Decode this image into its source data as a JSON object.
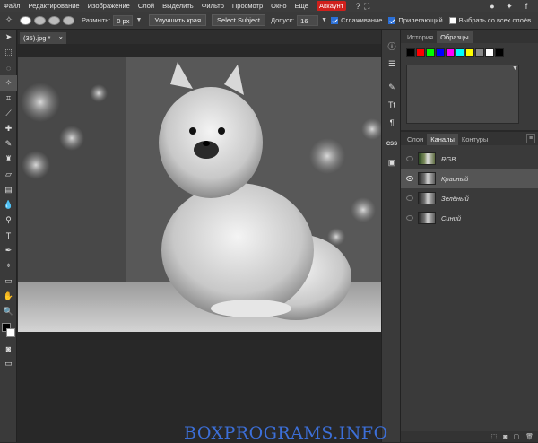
{
  "menubar": {
    "items": [
      "Файл",
      "Редактирование",
      "Изображение",
      "Слой",
      "Выделить",
      "Фильтр",
      "Просмотр",
      "Окно",
      "Ещё"
    ],
    "account": "Аккаунт"
  },
  "options": {
    "feather_label": "Размыть:",
    "feather_value": "0 px",
    "refine_edge": "Улучшить края",
    "select_subject": "Select Subject",
    "tolerance_label": "Допуск:",
    "tolerance_value": "16",
    "antialias_label": "Сглаживание",
    "contiguous_label": "Прилегающий",
    "sample_all_label": "Выбрать со всех слоёв"
  },
  "document": {
    "tab_name": "(35).jpg *",
    "close": "×"
  },
  "top_panel": {
    "tabs": [
      "История",
      "Образцы"
    ],
    "active_tab": 1,
    "swatches": [
      "#000000",
      "#ff0000",
      "#00ff00",
      "#0000ff",
      "#ff00ff",
      "#00ffff",
      "#ffff00",
      "#888888",
      "#ffffff",
      "#000000"
    ]
  },
  "layers_panel": {
    "tabs": [
      "Слои",
      "Каналы",
      "Контуры"
    ],
    "active_tab": 1,
    "channels": [
      {
        "name": "RGB"
      },
      {
        "name": "Красный"
      },
      {
        "name": "Зелёный"
      },
      {
        "name": "Синий"
      }
    ]
  },
  "sidestrip": {
    "css_label": "CSS"
  },
  "watermark": "BOXPROGRAMS.INFO"
}
